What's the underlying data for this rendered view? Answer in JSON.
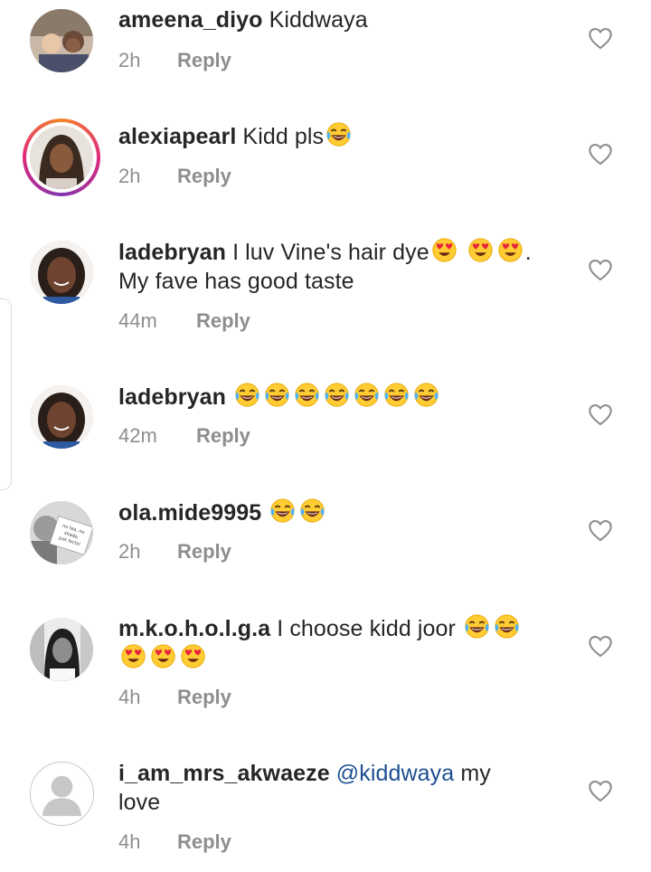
{
  "comments": [
    {
      "username": "ameena_diyo",
      "text": "Kiddwaya",
      "time": "2h",
      "reply": "Reply"
    },
    {
      "username": "alexiapearl",
      "text": "Kidd pls",
      "time": "2h",
      "reply": "Reply"
    },
    {
      "username": "ladebryan",
      "text": "I luv Vine's hair dye",
      "text_end": ".",
      "line2": "My fave has good taste",
      "time": "44m",
      "reply": "Reply"
    },
    {
      "username": "ladebryan",
      "text": "",
      "time": "42m",
      "reply": "Reply"
    },
    {
      "username": "ola.mide9995",
      "text": "",
      "time": "2h",
      "reply": "Reply"
    },
    {
      "username": "m.k.o.h.o.l.g.a",
      "text": "I choose kidd joor",
      "time": "4h",
      "reply": "Reply"
    },
    {
      "username": "i_am_mrs_akwaeze",
      "mention": "@kiddwaya",
      "text": "my",
      "line2": "love",
      "time": "4h",
      "reply": "Reply"
    }
  ],
  "avatar_photo_text": "no tea, no shade, just facts!",
  "icons": {
    "like": "heart-outline-icon",
    "laugh": "face-with-tears-of-joy-emoji",
    "love": "heart-eyes-emoji"
  },
  "colors": {
    "text": "#262626",
    "meta": "#8e8e8e",
    "mention": "#1d4f91"
  }
}
